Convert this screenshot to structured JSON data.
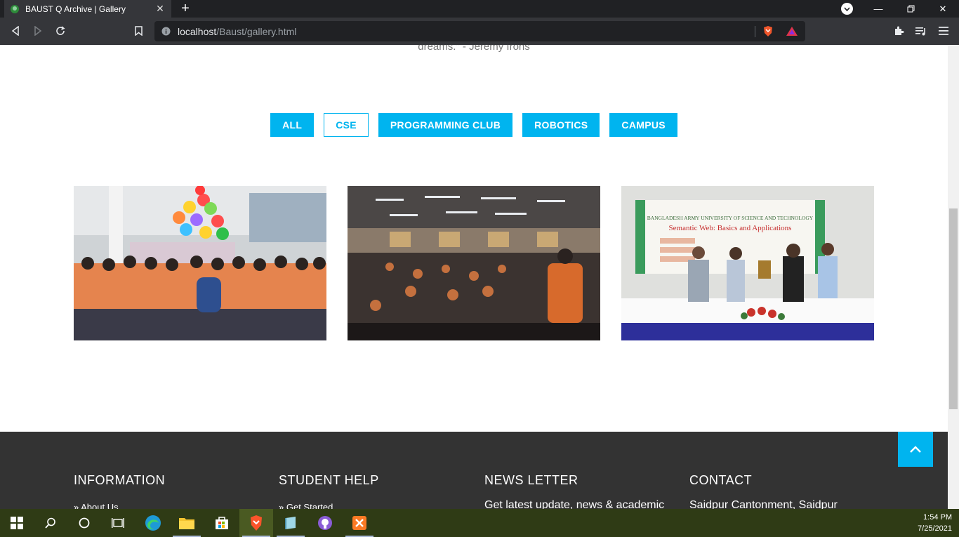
{
  "browser": {
    "tab_title": "BAUST Q Archive | Gallery",
    "url_host": "localhost",
    "url_path": "/Baust/gallery.html"
  },
  "page": {
    "quote_tail": "dreams.\" - Jeremy Irons",
    "filters": [
      "ALL",
      "CSE",
      "PROGRAMMING CLUB",
      "ROBOTICS",
      "CAMPUS"
    ],
    "active_filter": "CSE",
    "photos": [
      {
        "name": "gallery-photo-event-crowd-balloons"
      },
      {
        "name": "gallery-photo-auditorium-seminar"
      },
      {
        "name": "gallery-photo-award-ceremony"
      }
    ],
    "seminar_banner": {
      "line1": "BANGLADESH ARMY UNIVERSITY OF SCIENCE AND TECHNOLOGY",
      "line2": "Semantic Web: Basics and Applications"
    }
  },
  "footer": {
    "information": {
      "heading": "INFORMATION",
      "first_link": "About Us"
    },
    "student_help": {
      "heading": "STUDENT HELP",
      "first_link": "Get Started"
    },
    "newsletter": {
      "heading": "NEWS LETTER",
      "text": "Get latest update, news & academic"
    },
    "contact": {
      "heading": "CONTACT",
      "text": "Saidpur Cantonment, Saidpur"
    }
  },
  "taskbar": {
    "time": "1:54 PM",
    "date": "7/25/2021"
  },
  "colors": {
    "accent": "#00b4ef",
    "footer_bg": "#333333",
    "taskbar_bg": "#2f3b15"
  }
}
